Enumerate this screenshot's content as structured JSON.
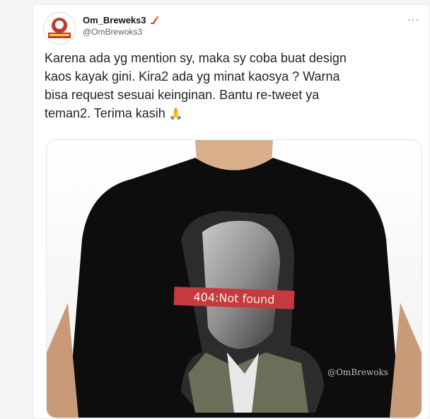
{
  "tweet": {
    "display_name": "Om_Breweks3",
    "handle": "@OmBrewoks3",
    "more_icon": "more-horizontal-icon",
    "verified_emoji": "hockey-stick-icon",
    "text": "Karena ada yg mention sy, maka sy coba buat design\nkaos kayak gini. Kira2 ada yg minat kaosya ? Warna\nbisa request sesuai keinginan. Bantu re-tweet ya\nteman2. Terima kasih",
    "prayer_emoji": "🙏"
  },
  "media": {
    "banner_text": "404:Not found",
    "watermark": "@OmBrewoks",
    "shirt_color": "#0d0d0d",
    "banner_color": "#c63a3e"
  }
}
